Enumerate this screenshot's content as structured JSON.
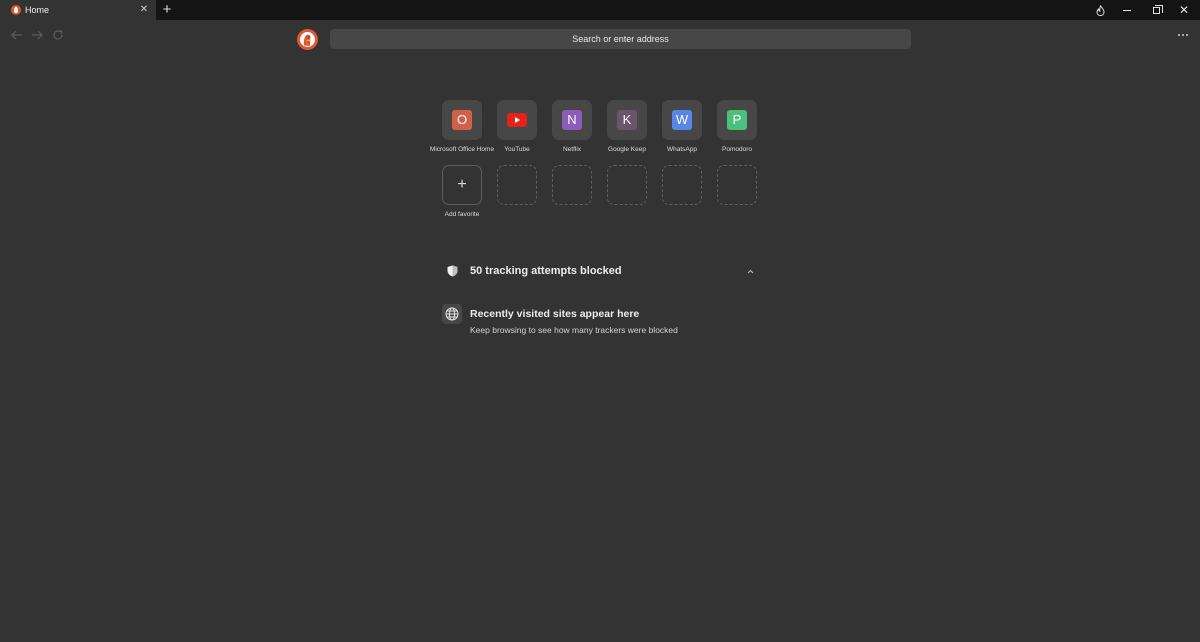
{
  "tab": {
    "title": "Home",
    "close_symbol": "✕",
    "new_tab_symbol": "+"
  },
  "window_controls": {
    "close_symbol": "✕"
  },
  "address_bar": {
    "placeholder": "Search or enter address"
  },
  "favorites": [
    {
      "label": "Microsoft Office Home",
      "letter": "O",
      "color": "#d0604a"
    },
    {
      "label": "YouTube",
      "letter": "",
      "color": "#e62117"
    },
    {
      "label": "Netflix",
      "letter": "N",
      "color": "#8a5cb8"
    },
    {
      "label": "Google Keep",
      "letter": "K",
      "color": "#6a5668"
    },
    {
      "label": "WhatsApp",
      "letter": "W",
      "color": "#5b85e6"
    },
    {
      "label": "Pomodoro",
      "letter": "P",
      "color": "#4cbf7e"
    }
  ],
  "add_favorite": {
    "symbol": "+",
    "label": "Add favorite"
  },
  "tracker": {
    "title": "50 tracking attempts blocked"
  },
  "recent": {
    "title": "Recently visited sites appear here",
    "subtitle": "Keep browsing to see how many trackers were blocked"
  },
  "colors": {
    "background": "#333333",
    "titlebar": "#141414",
    "surface": "#474747",
    "brand": "#de5833"
  }
}
